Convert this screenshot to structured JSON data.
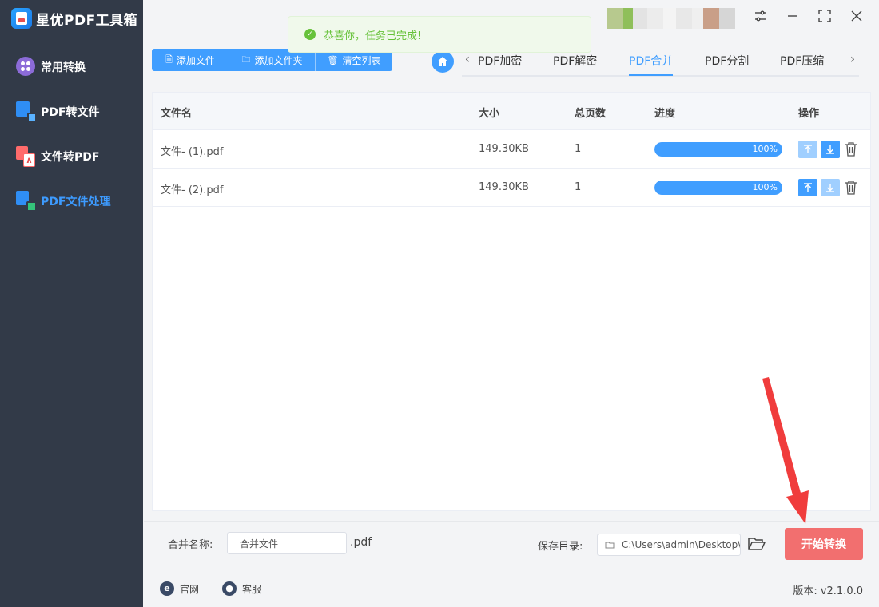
{
  "app": {
    "title": "星优PDF工具箱"
  },
  "sidebar": {
    "items": [
      {
        "label": "常用转换",
        "active": false
      },
      {
        "label": "PDF转文件",
        "active": false
      },
      {
        "label": "文件转PDF",
        "active": false
      },
      {
        "label": "PDF文件处理",
        "active": true
      }
    ]
  },
  "toast": {
    "message": "恭喜你，任务已完成!"
  },
  "toolbar": {
    "add_file": "添加文件",
    "add_folder": "添加文件夹",
    "clear_list": "清空列表"
  },
  "tabs": {
    "items": [
      "PDF加密",
      "PDF解密",
      "PDF合并",
      "PDF分割",
      "PDF压缩"
    ],
    "active": "PDF合并"
  },
  "table": {
    "headers": {
      "name": "文件名",
      "size": "大小",
      "pages": "总页数",
      "progress": "进度",
      "actions": "操作"
    },
    "rows": [
      {
        "name": "文件- (1).pdf",
        "size": "149.30KB",
        "pages": "1",
        "progress": 100,
        "progress_text": "100%",
        "up_enabled": false,
        "down_enabled": true
      },
      {
        "name": "文件- (2).pdf",
        "size": "149.30KB",
        "pages": "1",
        "progress": 100,
        "progress_text": "100%",
        "up_enabled": true,
        "down_enabled": false
      }
    ]
  },
  "merge": {
    "label": "合并名称:",
    "value": "合并文件",
    "ext": ".pdf"
  },
  "save": {
    "label": "保存目录:",
    "path": "C:\\Users\\admin\\Desktop\\"
  },
  "start_button": "开始转换",
  "footer": {
    "website": "官网",
    "support": "客服",
    "version": "版本: v2.1.0.0"
  },
  "colors": {
    "sidebar_bg": "#323a48",
    "accent": "#409eff",
    "start_button": "#f26f6f",
    "success": "#67c23a",
    "annotation_arrow": "#f03c3c"
  }
}
